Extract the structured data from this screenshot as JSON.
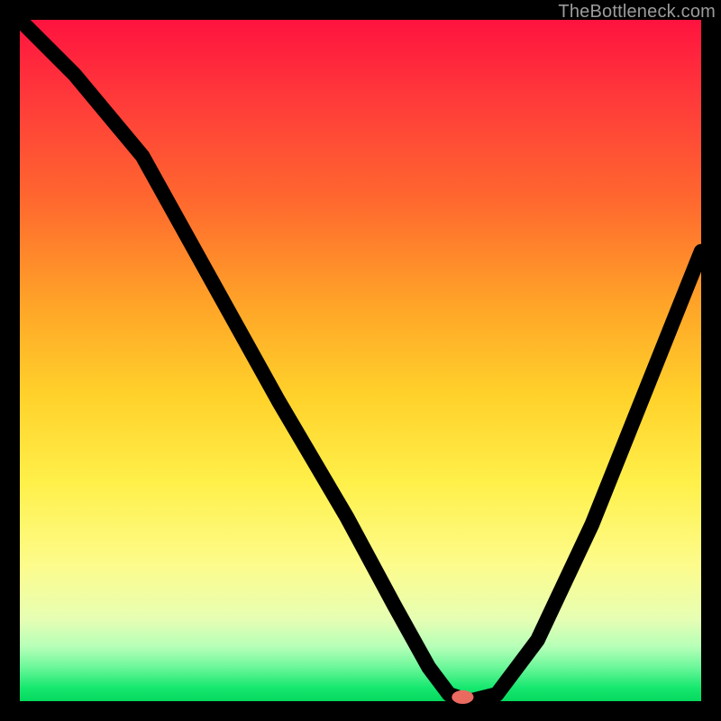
{
  "watermark": "TheBottleneck.com",
  "chart_data": {
    "type": "line",
    "title": "",
    "xlabel": "",
    "ylabel": "",
    "xlim": [
      0,
      100
    ],
    "ylim": [
      0,
      100
    ],
    "background_gradient_meaning": "red=bad, green=good (bottleneck severity)",
    "series": [
      {
        "name": "bottleneck-curve",
        "x": [
          0,
          8,
          18,
          28,
          38,
          48,
          55,
          60,
          63,
          66,
          70,
          76,
          84,
          92,
          100
        ],
        "y": [
          100,
          92,
          80,
          62,
          44,
          27,
          14,
          5,
          1,
          0,
          1,
          9,
          26,
          46,
          66
        ]
      }
    ],
    "marker": {
      "x": 65,
      "y": 0,
      "name": "optimal-point",
      "color": "#ea6a60"
    }
  }
}
